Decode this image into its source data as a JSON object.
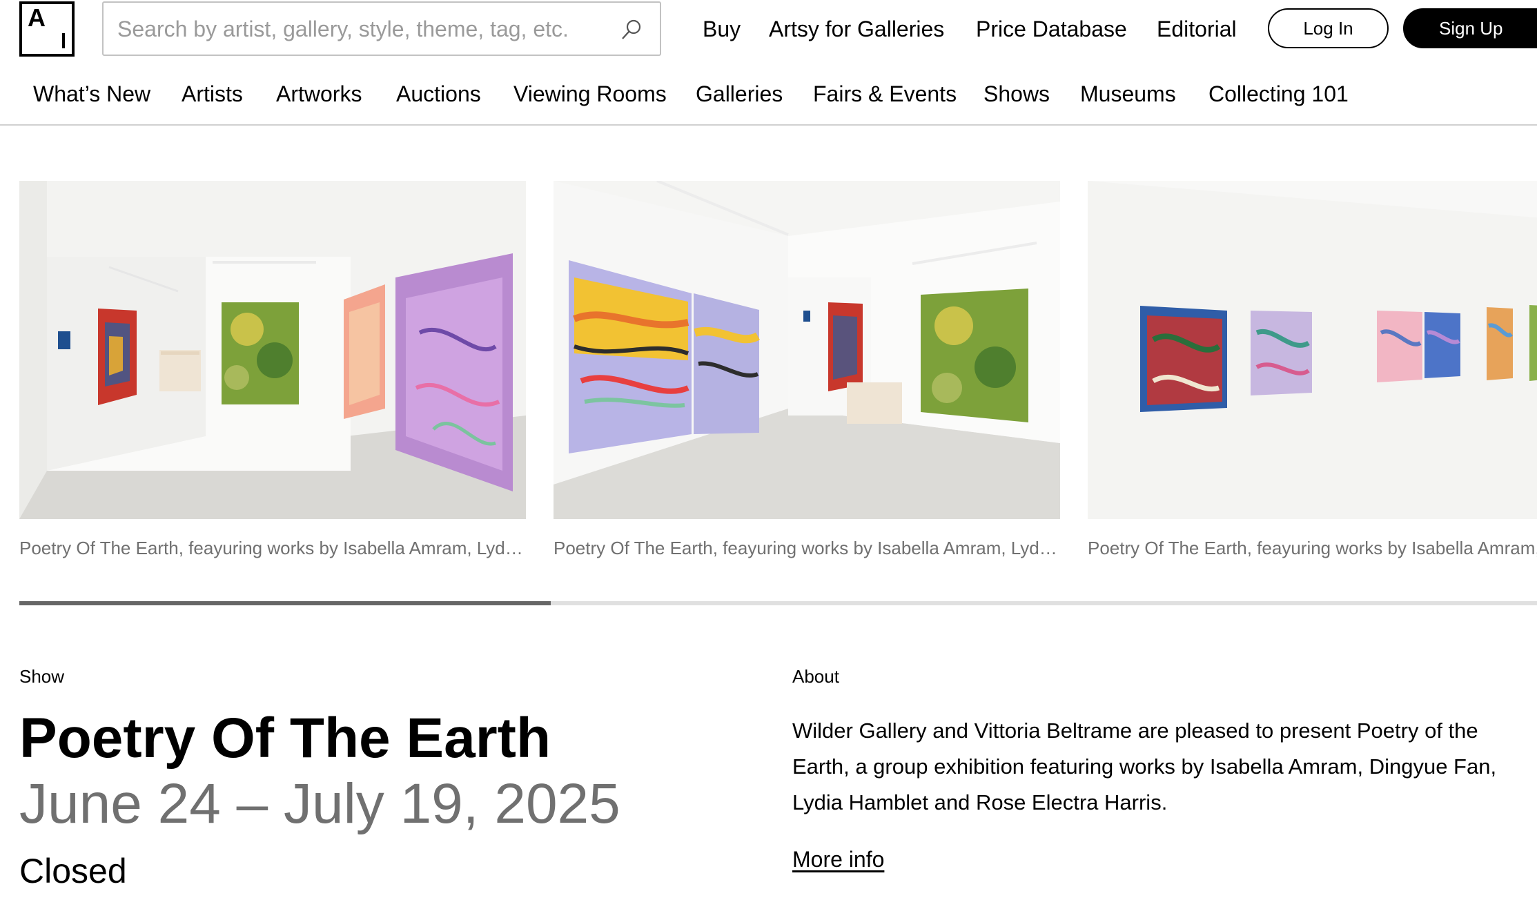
{
  "header": {
    "logo_text": "A",
    "search_placeholder": "Search by artist, gallery, style, theme, tag, etc.",
    "nav": [
      "Buy",
      "Artsy for Galleries",
      "Price Database",
      "Editorial"
    ],
    "login_label": "Log In",
    "signup_label": "Sign Up"
  },
  "subnav": [
    "What’s New",
    "Artists",
    "Artworks",
    "Auctions",
    "Viewing Rooms",
    "Galleries",
    "Fairs & Events",
    "Shows",
    "Museums",
    "Collecting 101"
  ],
  "carousel": {
    "slides": [
      {
        "caption": "Poetry Of The Earth, feayuring works by Isabella Amram, Lydia Hamblet, Dingyue Fan and Rose Electra Harris"
      },
      {
        "caption": "Poetry Of The Earth, feayuring works by Isabella Amram, Lydia Hamblet, Dingyue Fan and Rose Electra Harris"
      },
      {
        "caption": "Poetry Of The Earth, feayuring works by Isabella Amram, Lydia Hamblet, Dingyue Fan and Rose Electra Harris"
      }
    ],
    "scroll_progress": 0.35
  },
  "show": {
    "kind_label": "Show",
    "title": "Poetry Of The Earth",
    "dates": "June 24 – July 19, 2025",
    "status": "Closed"
  },
  "about": {
    "heading": "About",
    "text": "Wilder Gallery and Vittoria Beltrame are pleased to present Poetry of the Earth, a group exhibition featuring works by Isabella Amram, Dingyue Fan, Lydia Hamblet and Rose Electra Harris.",
    "more_info_label": "More info"
  },
  "colors": {
    "muted_text": "#707070",
    "scroll_thumb": "#666666",
    "divider": "#d0d0d0"
  }
}
